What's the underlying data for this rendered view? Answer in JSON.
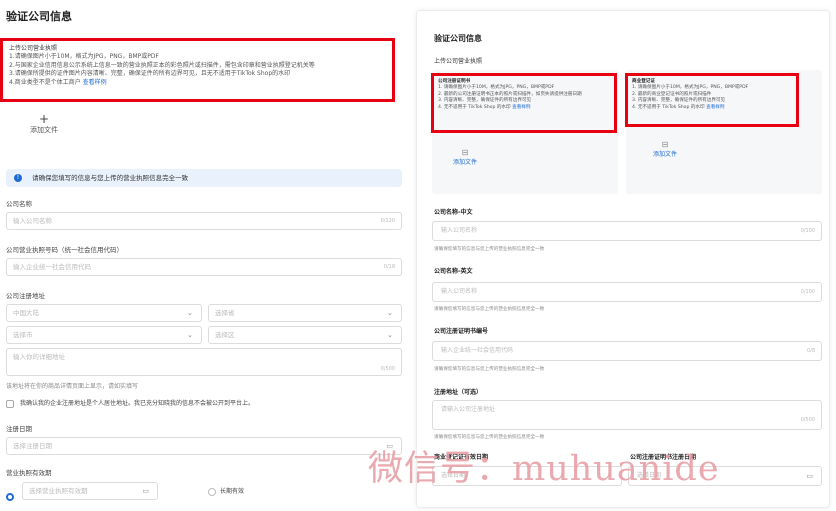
{
  "left": {
    "title": "验证公司信息",
    "requirements": {
      "head": "上传公司营业执照",
      "lines": [
        "1.请确保图片小于10M，格式为JPG，PNG，BMP或PDF",
        "2.与国家企业信用信息公示系统上信息一致的营业执照正本的彩色照片或扫描件，需包含印章和营业执照登记机关等",
        "3.请确保所提供的证件图片内容清晰、完整，确保证件的所有边界可见，且无不适用于TikTok Shop的水印",
        "4.商业类型不是个体工商户"
      ],
      "link": "查看样例"
    },
    "upload": {
      "plus": "+",
      "label": "添加文件"
    },
    "notice": {
      "icon": "!",
      "text": "请确保您填写的信息与您上传的营业执照信息完全一致"
    },
    "company_name": {
      "label": "公司名称",
      "placeholder": "输入公司名称",
      "counter": "0/120"
    },
    "credit_code": {
      "label": "公司营业执照号码（统一社会信用代码）",
      "placeholder": "输入企业统一社会信用代码",
      "counter": "0/18"
    },
    "address": {
      "label": "公司注册地址",
      "country": "中国大陆",
      "province": "选择省",
      "city": "选择市",
      "district": "选择区",
      "detail_placeholder": "输入你的详细地址",
      "counter": "0/500",
      "hint": "该地址将在你的商品详情页面上显示，请如实填写",
      "confirm": "我确认我的企业注册地址是个人居住地址。我已充分知晓我的信息不会被公开到平台上。"
    },
    "reg_date": {
      "label": "注册日期",
      "placeholder": "选择注册日期"
    },
    "validity": {
      "label": "营业执照有效期",
      "placeholder": "选择营业执照有效期",
      "long_term": "长期有效"
    }
  },
  "right": {
    "title": "验证公司信息",
    "sub": "上传公司营业执照",
    "card1": {
      "head": "公司注册证明书",
      "lines": [
        "1. 请确保图片小于10M，格式为JPG，PNG，BMP或PDF",
        "2. 最新的公司注册证明书正本的照片或扫描件，如页失请提供注册日期",
        "3. 内容清晰、完整，确保证件的所有边界可见",
        "4. 无不适用于 TikTok Shop 的水印"
      ],
      "link": "查看样例",
      "upload_label": "添加文件"
    },
    "card2": {
      "head": "商业登记证",
      "lines": [
        "1. 请确保图片小于10M，格式为JPG，PNG，BMP或PDF",
        "2. 最新的商业登记证书的照片或扫描件",
        "3. 内容清晰、完整，确保证件的所有边界可见",
        "4. 无不适用于 TikTok Shop 的水印"
      ],
      "link": "查看样例",
      "upload_label": "添加文件"
    },
    "name_cn": {
      "label": "公司名称-中文",
      "placeholder": "输入公司名称",
      "counter": "0/100",
      "hint": "请确保您填写的信息与您上传的营业执照信息完全一致"
    },
    "name_en": {
      "label": "公司名称-英文",
      "placeholder": "输入公司名称",
      "counter": "0/100",
      "hint": "请确保您填写的信息与您上传的营业执照信息完全一致"
    },
    "reg_no": {
      "label": "公司注册证明书编号",
      "placeholder": "输入企业统一社会信用代码",
      "counter": "0/8",
      "hint": "请确保您填写的信息与您上传的营业执照信息完全一致"
    },
    "address": {
      "label": "注册地址（可选）",
      "placeholder": "请输入公司注册地址",
      "counter": "0/500",
      "hint": "请确保您填写的信息与您上传的营业执照信息完全一致"
    },
    "biz_reg_date": {
      "label": "商业登记证有效日期",
      "placeholder": "选择日期"
    },
    "cert_reg_date": {
      "label": "公司注册证明书注册日期",
      "placeholder": "选择日期"
    }
  },
  "watermark": "微信号：muhuanide",
  "colors": {
    "highlight": "#e60012",
    "link": "#1f6bd6",
    "notice_bg": "#e8f1fc"
  }
}
